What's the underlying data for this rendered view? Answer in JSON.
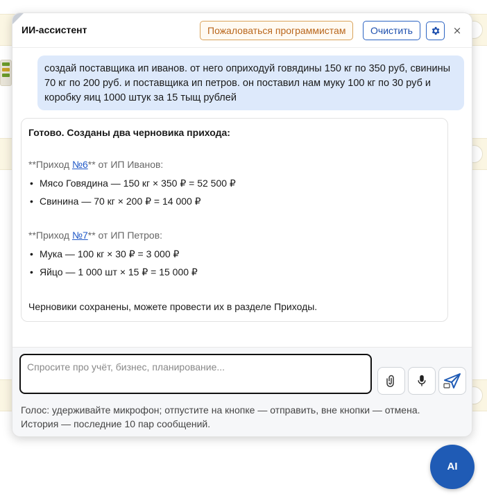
{
  "header": {
    "title": "ИИ-ассистент",
    "report_label": "Пожаловаться программистам",
    "clear_label": "Очистить",
    "settings_icon": "gear-icon",
    "close_label": "×"
  },
  "messages": {
    "user": "создай поставщика ип иванов. от него оприходуй говядины 150 кг по 350 руб, свинины 70 кг по 200 руб. и поставщика ип петров. он поставил нам муку 100 кг по 30 руб и коробку яиц 1000 штук за 15 тыщ рублей",
    "assistant": {
      "heading": "Готово. Созданы два черновика прихода:",
      "receipts": [
        {
          "prefix": "**Приход ",
          "number": "№6",
          "suffix": "** от ИП Иванов:",
          "items": [
            "Мясо Говядина — 150 кг × 350 ₽ = 52 500 ₽",
            "Свинина — 70 кг × 200 ₽ = 14 000 ₽"
          ]
        },
        {
          "prefix": "**Приход ",
          "number": "№7",
          "suffix": "** от ИП Петров:",
          "items": [
            "Мука — 100 кг × 30 ₽ = 3 000 ₽",
            "Яйцо — 1 000 шт × 15 ₽ = 15 000 ₽"
          ]
        }
      ],
      "footer": "Черновики сохранены, можете провести их в разделе Приходы."
    }
  },
  "composer": {
    "placeholder": "Спросите про учёт, бизнес, планирование...",
    "attach_icon": "paperclip-icon",
    "mic_icon": "microphone-icon",
    "send_icon": "send-icon",
    "hint_voice": "Голос: удерживайте микрофон; отпустите на кнопке — отправить, вне кнопки — отмена.",
    "hint_history": "История — последние 10 пар сообщений."
  },
  "fab": {
    "label": "AI"
  },
  "colors": {
    "accent": "#1f5bb5",
    "user_bubble": "#dde9fb",
    "report_button": "#b9661b",
    "background_strip": "#fbf6e3"
  }
}
